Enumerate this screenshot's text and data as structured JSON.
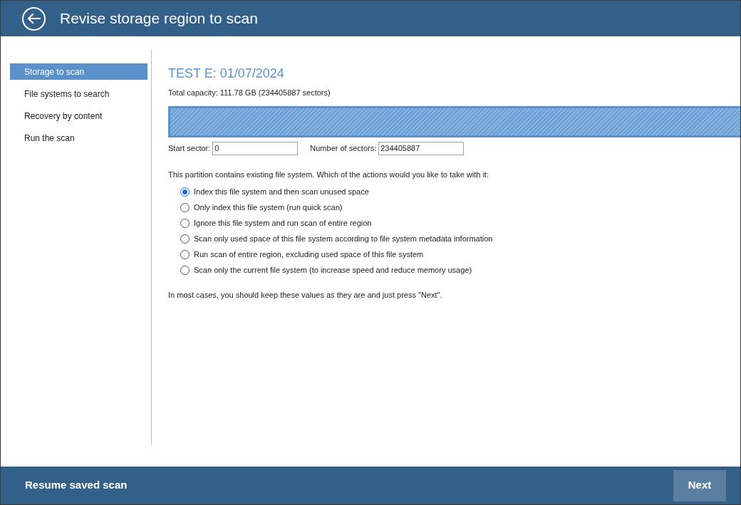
{
  "header": {
    "title": "Revise storage region to scan"
  },
  "sidebar": {
    "items": [
      {
        "label": "Storage to scan",
        "selected": true
      },
      {
        "label": "File systems to search",
        "selected": false
      },
      {
        "label": "Recovery by content",
        "selected": false
      },
      {
        "label": "Run the scan",
        "selected": false
      }
    ]
  },
  "content": {
    "title": "TEST E: 01/07/2024",
    "capacity": "Total capacity: 111.78 GB (234405887 sectors)",
    "start_sector": {
      "label": "Start sector:",
      "value": "0"
    },
    "number_of_sectors": {
      "label": "Number of sectors:",
      "value": "234405887"
    },
    "question": "This partition contains existing file system. Which of the actions would you like to take with it:",
    "options": [
      {
        "label": "Index this file system and then scan unused space",
        "selected": true
      },
      {
        "label": "Only index this file system (run quick scan)",
        "selected": false
      },
      {
        "label": "Ignore this file system and run scan of entire region",
        "selected": false
      },
      {
        "label": "Scan only used space of this file system according to file system metadata information",
        "selected": false
      },
      {
        "label": "Run scan of entire region, excluding used space of this file system",
        "selected": false
      },
      {
        "label": "Scan only the current file system (to increase speed and reduce memory usage)",
        "selected": false
      }
    ],
    "hint": "In most cases, you should keep these values as they are and just press \"Next\"."
  },
  "footer": {
    "left_button": "Resume saved scan",
    "next_button": "Next"
  }
}
